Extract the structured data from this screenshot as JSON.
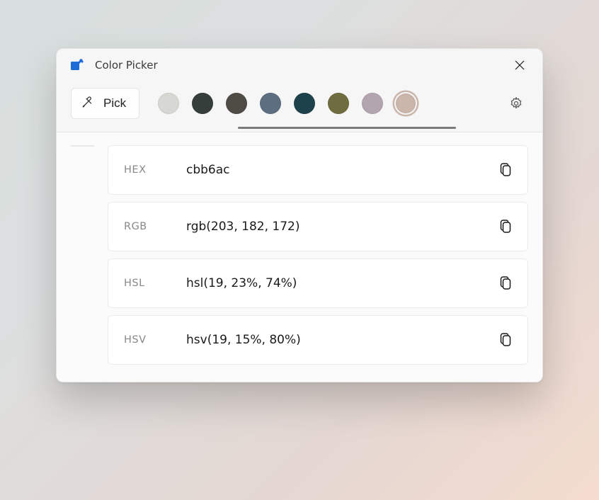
{
  "window": {
    "title": "Color Picker"
  },
  "toolbar": {
    "pick_label": "Pick",
    "swatches": [
      {
        "color": "#d7d7d3",
        "selected": false
      },
      {
        "color": "#353e3a",
        "selected": false
      },
      {
        "color": "#4d4b44",
        "selected": false
      },
      {
        "color": "#5d6e80",
        "selected": false
      },
      {
        "color": "#1e424b",
        "selected": false
      },
      {
        "color": "#6f6c3f",
        "selected": false
      },
      {
        "color": "#b3a5af",
        "selected": false
      },
      {
        "color": "#cbb6ac",
        "selected": true
      }
    ]
  },
  "shades": [
    "#ffdccd",
    "#fad1c0",
    "#c8b3a9",
    "#c3aea4",
    "#ae9b92",
    "#887a72",
    "#756860"
  ],
  "formats": [
    {
      "label": "HEX",
      "value": "cbb6ac"
    },
    {
      "label": "RGB",
      "value": "rgb(203, 182, 172)"
    },
    {
      "label": "HSL",
      "value": "hsl(19, 23%, 74%)"
    },
    {
      "label": "HSV",
      "value": "hsv(19, 15%, 80%)"
    }
  ]
}
